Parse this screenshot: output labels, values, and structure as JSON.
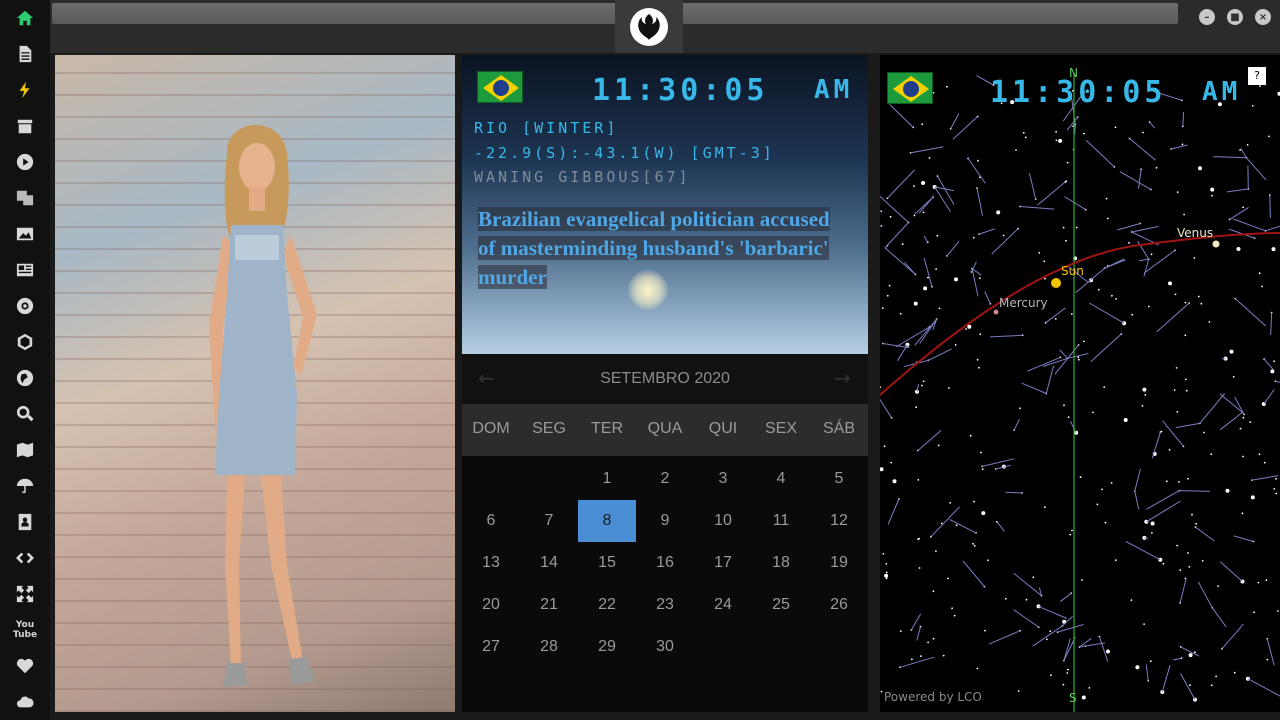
{
  "sidebar": {
    "icons": [
      "home-icon",
      "document-icon",
      "bolt-icon",
      "archive-icon",
      "play-icon",
      "translate-icon",
      "image-icon",
      "newspaper-icon",
      "settings-wheel-icon",
      "network-icon",
      "globe-icon",
      "search-icon",
      "map-icon",
      "umbrella-icon",
      "contacts-icon",
      "code-icon",
      "expand-icon",
      "youtube-icon",
      "heart-icon",
      "cloud-icon"
    ],
    "youtube_text": "You\nTube",
    "accent": "#2ecc71"
  },
  "clock": {
    "time": "11:30:05",
    "ampm": "AM",
    "location": "RIO [WINTER]",
    "coords": "-22.9(S):-43.1(W) [GMT-3]",
    "moon": "WANING GIBBOUS[67]",
    "headline": "Brazilian evangelical politician accused of masterminding husband's 'barbaric' murder"
  },
  "calendar": {
    "title": "SETEMBRO 2020",
    "prev": "←",
    "next": "→",
    "weekdays": [
      "DOM",
      "SEG",
      "TER",
      "QUA",
      "QUI",
      "SEX",
      "SÁB"
    ],
    "weeks": [
      [
        "",
        "",
        "1",
        "2",
        "3",
        "4",
        "5"
      ],
      [
        "6",
        "7",
        "8",
        "9",
        "10",
        "11",
        "12"
      ],
      [
        "13",
        "14",
        "15",
        "16",
        "17",
        "18",
        "19"
      ],
      [
        "20",
        "21",
        "22",
        "23",
        "24",
        "25",
        "26"
      ],
      [
        "27",
        "28",
        "29",
        "30",
        "",
        "",
        ""
      ]
    ],
    "today": "8",
    "today_color": "#4a8ed6"
  },
  "starchart": {
    "time": "11:30:05",
    "ampm": "AM",
    "north": "N",
    "south": "S",
    "help": "?",
    "planets": {
      "sun": "Sun",
      "venus": "Venus",
      "mercury": "Mercury"
    },
    "credit": "Powered by LCO"
  }
}
